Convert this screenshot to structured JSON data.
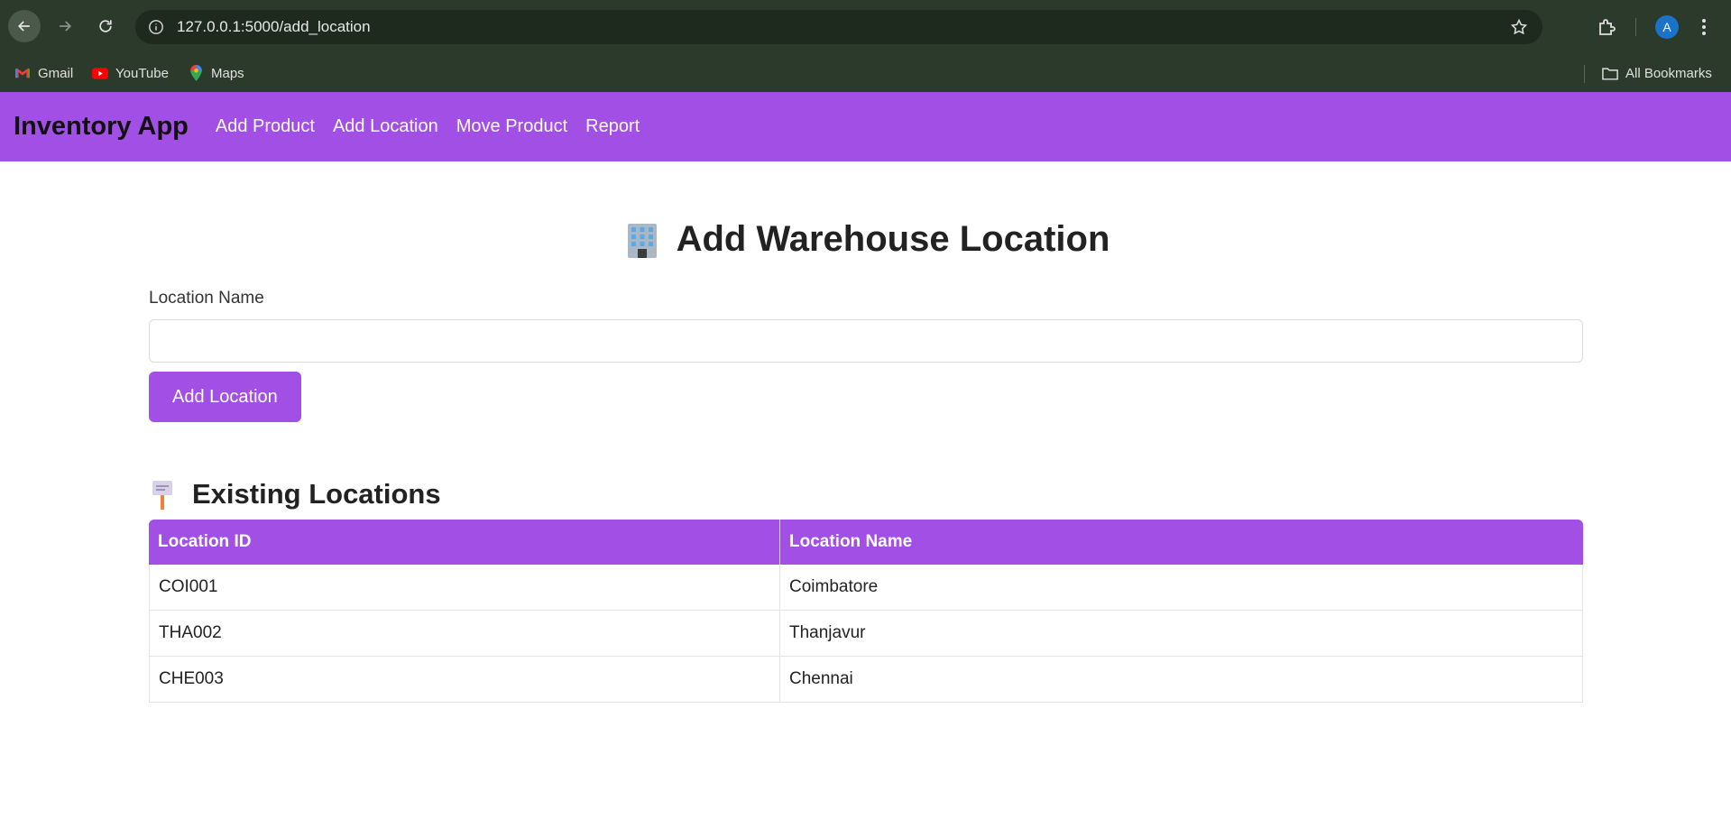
{
  "browser": {
    "url": "127.0.0.1:5000/add_location",
    "avatar_letter": "A",
    "bookmarks": [
      {
        "label": "Gmail",
        "icon": "gmail-icon"
      },
      {
        "label": "YouTube",
        "icon": "youtube-icon"
      },
      {
        "label": "Maps",
        "icon": "maps-icon"
      }
    ],
    "all_bookmarks_label": "All Bookmarks"
  },
  "navbar": {
    "brand": "Inventory App",
    "links": [
      "Add Product",
      "Add Location",
      "Move Product",
      "Report"
    ],
    "color": "#a24fe6"
  },
  "form": {
    "title": "Add Warehouse Location",
    "title_icon": "office-building-icon",
    "field_label": "Location Name",
    "field_value": "",
    "field_placeholder": "",
    "submit_label": "Add Location"
  },
  "locations": {
    "title": "Existing Locations",
    "title_icon": "placard-icon",
    "columns": [
      "Location ID",
      "Location Name"
    ],
    "rows": [
      [
        "COI001",
        "Coimbatore"
      ],
      [
        "THA002",
        "Thanjavur"
      ],
      [
        "CHE003",
        "Chennai"
      ]
    ]
  }
}
